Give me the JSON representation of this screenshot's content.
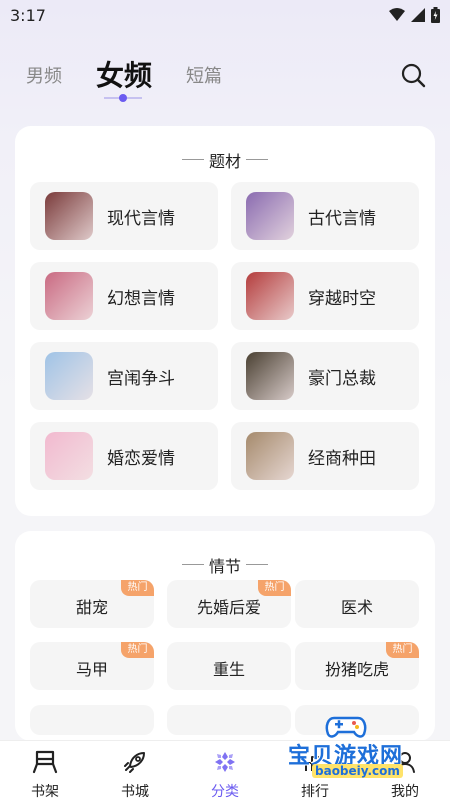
{
  "status_bar": {
    "time": "3:17"
  },
  "top_tabs": {
    "tabs": [
      "男频",
      "女频",
      "短篇"
    ],
    "active": "女频"
  },
  "themes": {
    "title": "题材",
    "items": [
      {
        "label": "现代言情",
        "thumb_color": "#7a3b3b"
      },
      {
        "label": "古代言情",
        "thumb_color": "#8a6bb0"
      },
      {
        "label": "幻想言情",
        "thumb_color": "#c96a82"
      },
      {
        "label": "穿越时空",
        "thumb_color": "#b43d3d"
      },
      {
        "label": "宫闱争斗",
        "thumb_color": "#9fc3e6"
      },
      {
        "label": "豪门总裁",
        "thumb_color": "#4a4032"
      },
      {
        "label": "婚恋爱情",
        "thumb_color": "#f2b9cf"
      },
      {
        "label": "经商种田",
        "thumb_color": "#a58a6c"
      }
    ]
  },
  "plots": {
    "title": "情节",
    "hot_label": "热门",
    "items": [
      {
        "label": "甜宠",
        "hot": true
      },
      {
        "label": "先婚后爱",
        "hot": true
      },
      {
        "label": "医术",
        "hot": false
      },
      {
        "label": "马甲",
        "hot": true
      },
      {
        "label": "重生",
        "hot": false
      },
      {
        "label": "扮猪吃虎",
        "hot": true
      }
    ]
  },
  "bottom_nav": {
    "items": [
      {
        "label": "书架",
        "icon": "bookshelf-icon"
      },
      {
        "label": "书城",
        "icon": "rocket-icon"
      },
      {
        "label": "分类",
        "icon": "category-icon"
      },
      {
        "label": "排行",
        "icon": "ranking-icon"
      },
      {
        "label": "我的",
        "icon": "profile-icon"
      }
    ],
    "active": "分类"
  },
  "watermark": {
    "text": "宝贝游戏网",
    "url": "baobeiy.com"
  },
  "colors": {
    "accent": "#6b5bf0",
    "hot_badge": "#f5a36a",
    "card_bg": "#ffffff",
    "item_bg": "#f5f5f5"
  }
}
